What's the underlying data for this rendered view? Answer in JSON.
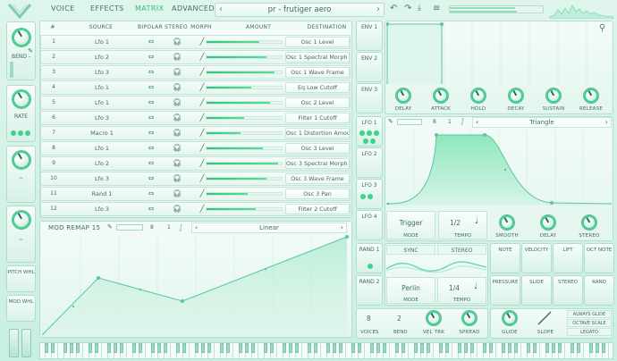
{
  "header": {
    "tabs": [
      "VOICE",
      "EFFECTS",
      "MATRIX",
      "ADVANCED"
    ],
    "active_tab": "MATRIX",
    "preset_name": "pr - frutiger aero",
    "prev_arrow": "‹",
    "next_arrow": "›"
  },
  "left_strip": {
    "labels": [
      "BEND -",
      "RATE",
      "~",
      "~",
      "PITCH WHL",
      "MOD WHL"
    ]
  },
  "matrix": {
    "columns": [
      "#",
      "SOURCE",
      "BIPOLAR",
      "STEREO",
      "MORPH",
      "AMOUNT",
      "DESTINATION"
    ],
    "rows": [
      {
        "num": "1",
        "source": "Lfo 1",
        "amount": 0.7,
        "destination": "Osc 1 Level"
      },
      {
        "num": "2",
        "source": "Lfo 2",
        "amount": 0.8,
        "destination": "Osc 1 Spectral Morph A"
      },
      {
        "num": "3",
        "source": "Lfo 3",
        "amount": 0.9,
        "destination": "Osc 1 Wave Frame"
      },
      {
        "num": "4",
        "source": "Lfo 1",
        "amount": 0.6,
        "destination": "Eq Low Cutoff"
      },
      {
        "num": "5",
        "source": "Lfo 1",
        "amount": 0.85,
        "destination": "Osc 2 Level"
      },
      {
        "num": "6",
        "source": "Lfo 3",
        "amount": 0.5,
        "destination": "Filter 1 Cutoff"
      },
      {
        "num": "7",
        "source": "Macro 1",
        "amount": 0.45,
        "destination": "Osc 1 Distortion Amount"
      },
      {
        "num": "8",
        "source": "Lfo 1",
        "amount": 0.75,
        "destination": "Osc 3 Level"
      },
      {
        "num": "9",
        "source": "Lfo 2",
        "amount": 0.95,
        "destination": "Osc 3 Spectral Morph A"
      },
      {
        "num": "10",
        "source": "Lfo 3",
        "amount": 0.8,
        "destination": "Osc 3 Wave Frame"
      },
      {
        "num": "11",
        "source": "Rand 1",
        "amount": 0.55,
        "destination": "Osc 3 Pan"
      },
      {
        "num": "12",
        "source": "Lfo 3",
        "amount": 0.65,
        "destination": "Filter 2 Cutoff"
      }
    ]
  },
  "remap": {
    "title": "MOD REMAP 15",
    "grid_x": "8",
    "grid_y": "1",
    "curve": "Linear"
  },
  "env": {
    "tabs": [
      "ENV 1",
      "ENV 2",
      "ENV 3"
    ],
    "knobs": [
      "DELAY",
      "ATTACK",
      "HOLD",
      "DECAY",
      "SUSTAIN",
      "RELEASE"
    ]
  },
  "lfo": {
    "tabs": [
      "LFO 1",
      "LFO 2",
      "LFO 3",
      "LFO 4"
    ],
    "grid_x": "8",
    "grid_y": "1",
    "shape": "Triangle",
    "mode_value": "Trigger",
    "mode_label": "MODE",
    "tempo_value": "1/2",
    "tempo_label": "TEMPO",
    "knobs": [
      "SMOOTH",
      "DELAY",
      "STEREO"
    ]
  },
  "rand": {
    "tabs": [
      "RAND 1",
      "RAND 2"
    ],
    "sync_label": "SYNC",
    "stereo_label": "STEREO",
    "mode_value": "Perlin",
    "mode_label": "MODE",
    "tempo_value": "1/4",
    "tempo_label": "TEMPO"
  },
  "sources": {
    "row1": [
      "NOTE",
      "VELOCITY",
      "LIFT",
      "OCT NOTE"
    ],
    "row2": [
      "PRESSURE",
      "SLIDE",
      "STEREO",
      "RAND"
    ]
  },
  "voice": {
    "voices_value": "8",
    "voices_label": "VOICES",
    "bend_value": "2",
    "bend_label": "BEND",
    "veltrk_label": "VEL TRK",
    "spread_label": "SPREAD",
    "glide_label": "GLIDE",
    "slope_label": "SLOPE",
    "opts": [
      "ALWAYS GLIDE",
      "OCTAVE SCALE",
      "LEGATO"
    ]
  }
}
